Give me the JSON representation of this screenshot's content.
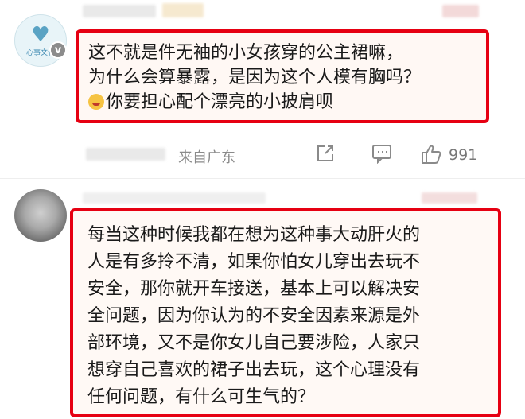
{
  "comment1": {
    "avatar_text": "心事文化",
    "lines": [
      "这不就是件无袖的小女孩穿的公主裙嘛，",
      "为什么会算暴露，是因为这个人模有胸吗？",
      "你要担心配个漂亮的小披肩呗"
    ],
    "location": "来自广东",
    "like_count": "991",
    "icons": [
      "share-icon",
      "comment-icon",
      "like-icon"
    ]
  },
  "comment2": {
    "lines": [
      "每当这种时候我都在想为这种事大动肝火的",
      "人是有多拎不清，如果你怕女儿穿出去玩不",
      "安全，那你就开车接送，基本上可以解决安",
      "全问题，因为你认为的不安全因素来源是外",
      "部环境，又不是你女儿自己要涉险，人家只",
      "想穿自己喜欢的裙子出去玩，这个心理没有",
      "任何问题，有什么可生气的？"
    ]
  },
  "colors": {
    "highlight_border": "#e60012",
    "muted_text": "#8a8a8a"
  }
}
